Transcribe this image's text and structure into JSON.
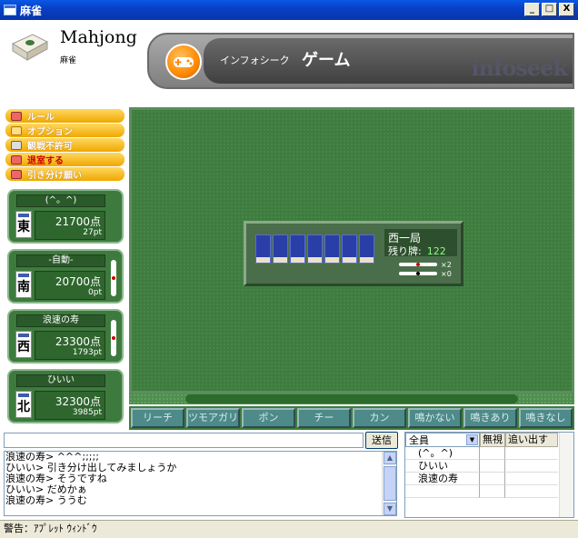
{
  "window": {
    "title": "麻雀",
    "btn_min": "_",
    "btn_max": "□",
    "btn_close": "X"
  },
  "header": {
    "app_title": "Mahjong",
    "app_subtitle": "麻雀",
    "brand": "インフォシーク",
    "section": "ゲーム",
    "logo_text": "infoseek"
  },
  "menu": [
    {
      "label": "ルール"
    },
    {
      "label": "オプション"
    },
    {
      "label": "観戦不許可"
    },
    {
      "label": "退室する"
    },
    {
      "label": "引き分け願い"
    }
  ],
  "players": [
    {
      "name": "(^。^)",
      "wind": "東",
      "score": "21700点",
      "pt": "27pt"
    },
    {
      "name": "-自動-",
      "wind": "南",
      "score": "20700点",
      "pt": "0pt"
    },
    {
      "name": "浪速の寿",
      "wind": "西",
      "score": "23300点",
      "pt": "1793pt"
    },
    {
      "name": "ひいい",
      "wind": "北",
      "score": "32300点",
      "pt": "3985pt"
    }
  ],
  "board": {
    "round": "西一局",
    "remain_label": "残り牌:",
    "remain_value": "122",
    "riichi_count": "×2",
    "hundred_count": "×0"
  },
  "actions": [
    "リーチ",
    "ツモアガリ",
    "ポン",
    "チー",
    "カン",
    "鳴かない",
    "鳴きあり",
    "鳴きなし"
  ],
  "chat": {
    "input_value": "",
    "send_label": "送信",
    "lines": [
      "浪速の寿> ^^^;;;;;",
      "ひいい> 引き分け出してみましょうか",
      "浪速の寿> そうですね",
      "ひいい> だめかぁ",
      "浪速の寿> ううむ"
    ]
  },
  "users": {
    "filter": "全員",
    "col_ignore": "無視",
    "col_kick": "追い出す",
    "names": [
      "(^。^)",
      "ひいい",
      "浪速の寿"
    ]
  },
  "status": "警告：ｱﾌﾟﾚｯﾄ ｳｨﾝﾄﾞｳ"
}
